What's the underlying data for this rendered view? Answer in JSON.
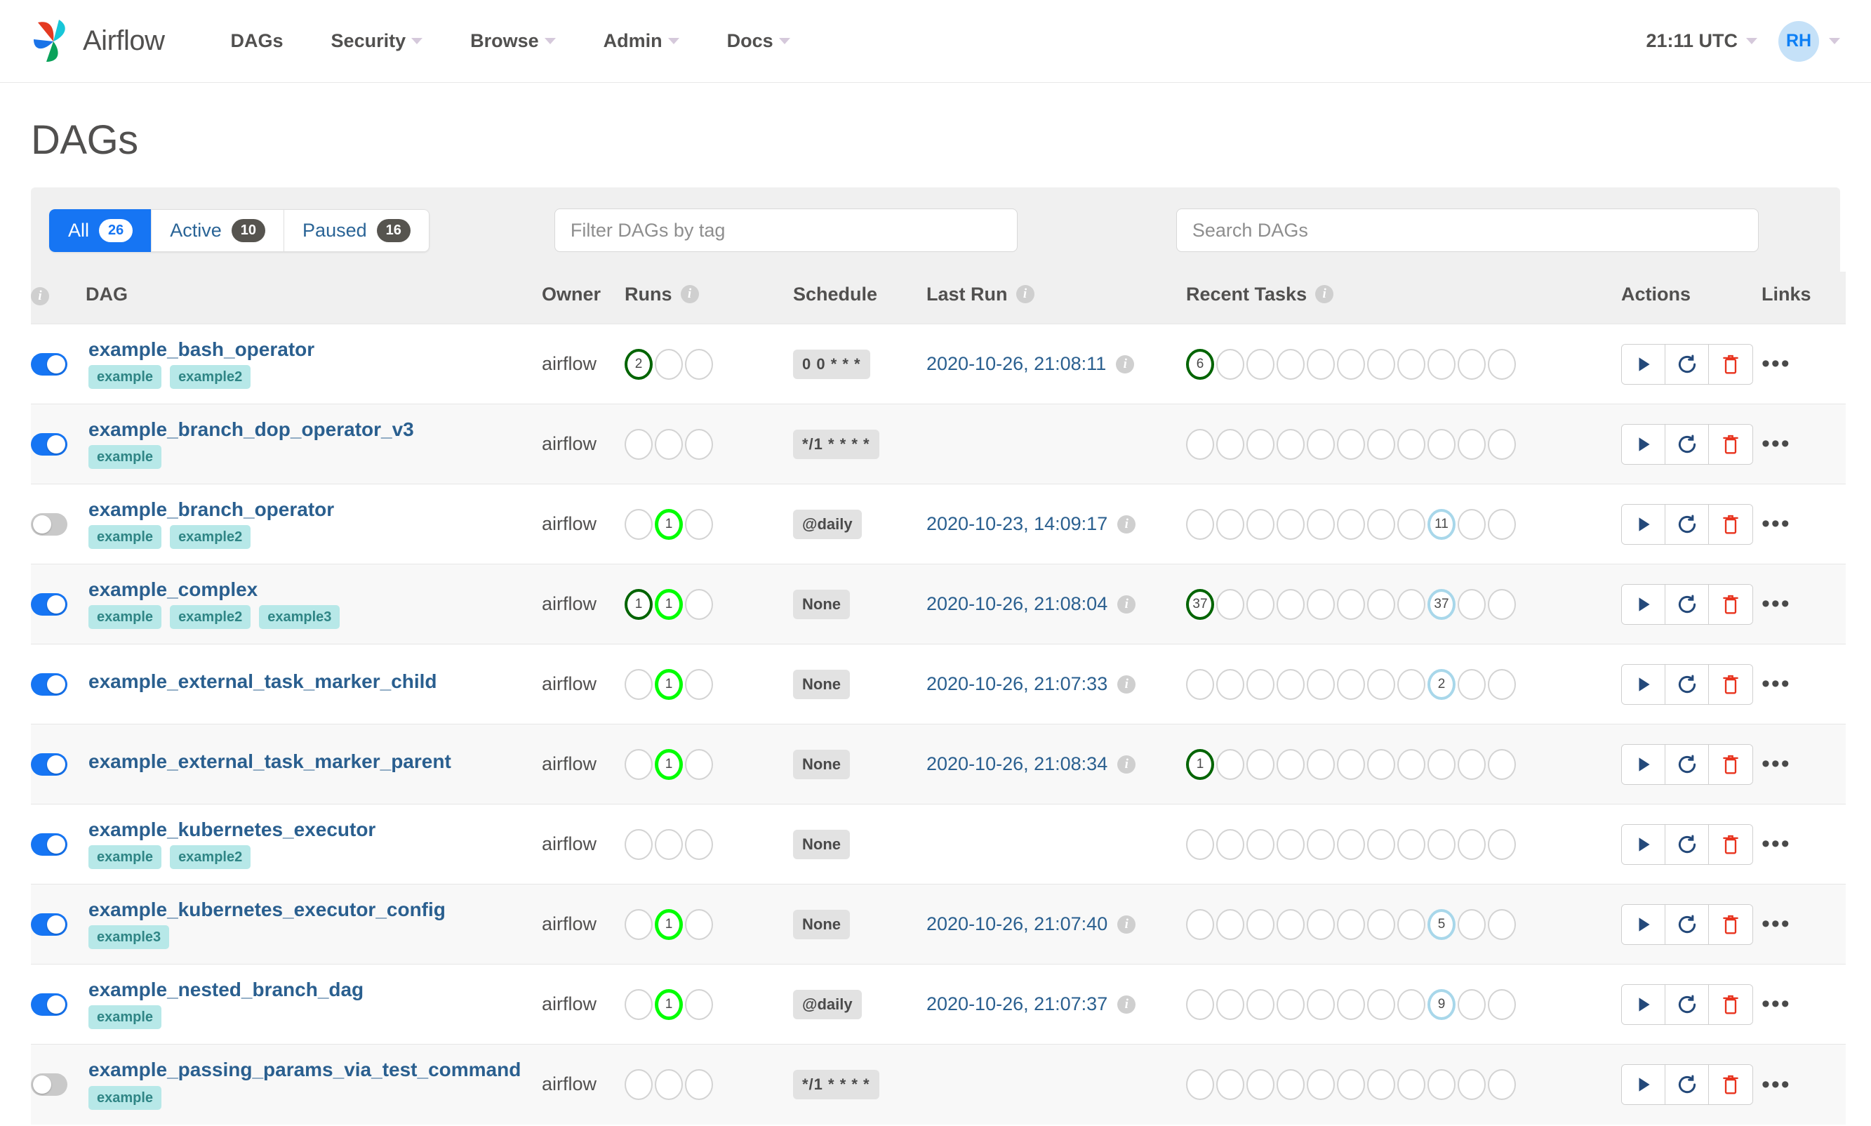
{
  "navbar": {
    "brand": "Airflow",
    "links": [
      {
        "label": "DAGs",
        "caret": false
      },
      {
        "label": "Security",
        "caret": true
      },
      {
        "label": "Browse",
        "caret": true
      },
      {
        "label": "Admin",
        "caret": true
      },
      {
        "label": "Docs",
        "caret": true
      }
    ],
    "time": "21:11 UTC",
    "avatar_initials": "RH"
  },
  "page": {
    "title": "DAGs"
  },
  "toolbar": {
    "tabs": [
      {
        "label": "All",
        "count": "26",
        "active": true
      },
      {
        "label": "Active",
        "count": "10",
        "active": false
      },
      {
        "label": "Paused",
        "count": "16",
        "active": false
      }
    ],
    "tag_filter_placeholder": "Filter DAGs by tag",
    "search_placeholder": "Search DAGs"
  },
  "table": {
    "headers": {
      "dag": "DAG",
      "owner": "Owner",
      "runs": "Runs",
      "schedule": "Schedule",
      "last_run": "Last Run",
      "recent_tasks": "Recent Tasks",
      "actions": "Actions",
      "links": "Links"
    },
    "action_icons": [
      "trigger-dag-icon",
      "refresh-icon",
      "delete-icon"
    ],
    "links_icon": "more-options-icon",
    "rows": [
      {
        "name": "example_bash_operator",
        "paused": false,
        "tags": [
          "example",
          "example2"
        ],
        "owner": "airflow",
        "runs": [
          {
            "state": "success",
            "count": "2"
          },
          {
            "state": "none",
            "count": ""
          },
          {
            "state": "none",
            "count": ""
          }
        ],
        "schedule": "0 0 * * *",
        "schedule_kind": "cron",
        "last_run": "2020-10-26, 21:08:11",
        "recent_tasks": [
          {
            "state": "success",
            "count": "6"
          },
          {
            "state": "none",
            "count": ""
          },
          {
            "state": "none",
            "count": ""
          },
          {
            "state": "none",
            "count": ""
          },
          {
            "state": "none",
            "count": ""
          },
          {
            "state": "none",
            "count": ""
          },
          {
            "state": "none",
            "count": ""
          },
          {
            "state": "none",
            "count": ""
          },
          {
            "state": "none",
            "count": ""
          },
          {
            "state": "none",
            "count": ""
          },
          {
            "state": "none",
            "count": ""
          }
        ]
      },
      {
        "name": "example_branch_dop_operator_v3",
        "paused": false,
        "tags": [
          "example"
        ],
        "owner": "airflow",
        "runs": [
          {
            "state": "none",
            "count": ""
          },
          {
            "state": "none",
            "count": ""
          },
          {
            "state": "none",
            "count": ""
          }
        ],
        "schedule": "*/1 * * * *",
        "schedule_kind": "cron",
        "last_run": "",
        "recent_tasks": [
          {
            "state": "none",
            "count": ""
          },
          {
            "state": "none",
            "count": ""
          },
          {
            "state": "none",
            "count": ""
          },
          {
            "state": "none",
            "count": ""
          },
          {
            "state": "none",
            "count": ""
          },
          {
            "state": "none",
            "count": ""
          },
          {
            "state": "none",
            "count": ""
          },
          {
            "state": "none",
            "count": ""
          },
          {
            "state": "none",
            "count": ""
          },
          {
            "state": "none",
            "count": ""
          },
          {
            "state": "none",
            "count": ""
          }
        ]
      },
      {
        "name": "example_branch_operator",
        "paused": true,
        "tags": [
          "example",
          "example2"
        ],
        "owner": "airflow",
        "runs": [
          {
            "state": "none",
            "count": ""
          },
          {
            "state": "running",
            "count": "1"
          },
          {
            "state": "none",
            "count": ""
          }
        ],
        "schedule": "@daily",
        "schedule_kind": "word",
        "last_run": "2020-10-23, 14:09:17",
        "recent_tasks": [
          {
            "state": "none",
            "count": ""
          },
          {
            "state": "none",
            "count": ""
          },
          {
            "state": "none",
            "count": ""
          },
          {
            "state": "none",
            "count": ""
          },
          {
            "state": "none",
            "count": ""
          },
          {
            "state": "none",
            "count": ""
          },
          {
            "state": "none",
            "count": ""
          },
          {
            "state": "none",
            "count": ""
          },
          {
            "state": "skipped",
            "count": "11"
          },
          {
            "state": "none",
            "count": ""
          },
          {
            "state": "none",
            "count": ""
          }
        ]
      },
      {
        "name": "example_complex",
        "paused": false,
        "tags": [
          "example",
          "example2",
          "example3"
        ],
        "owner": "airflow",
        "runs": [
          {
            "state": "success",
            "count": "1"
          },
          {
            "state": "running",
            "count": "1"
          },
          {
            "state": "none",
            "count": ""
          }
        ],
        "schedule": "None",
        "schedule_kind": "word",
        "last_run": "2020-10-26, 21:08:04",
        "recent_tasks": [
          {
            "state": "success",
            "count": "37"
          },
          {
            "state": "none",
            "count": ""
          },
          {
            "state": "none",
            "count": ""
          },
          {
            "state": "none",
            "count": ""
          },
          {
            "state": "none",
            "count": ""
          },
          {
            "state": "none",
            "count": ""
          },
          {
            "state": "none",
            "count": ""
          },
          {
            "state": "none",
            "count": ""
          },
          {
            "state": "skipped",
            "count": "37"
          },
          {
            "state": "none",
            "count": ""
          },
          {
            "state": "none",
            "count": ""
          }
        ]
      },
      {
        "name": "example_external_task_marker_child",
        "paused": false,
        "tags": [],
        "owner": "airflow",
        "runs": [
          {
            "state": "none",
            "count": ""
          },
          {
            "state": "running",
            "count": "1"
          },
          {
            "state": "none",
            "count": ""
          }
        ],
        "schedule": "None",
        "schedule_kind": "word",
        "last_run": "2020-10-26, 21:07:33",
        "recent_tasks": [
          {
            "state": "none",
            "count": ""
          },
          {
            "state": "none",
            "count": ""
          },
          {
            "state": "none",
            "count": ""
          },
          {
            "state": "none",
            "count": ""
          },
          {
            "state": "none",
            "count": ""
          },
          {
            "state": "none",
            "count": ""
          },
          {
            "state": "none",
            "count": ""
          },
          {
            "state": "none",
            "count": ""
          },
          {
            "state": "skipped",
            "count": "2"
          },
          {
            "state": "none",
            "count": ""
          },
          {
            "state": "none",
            "count": ""
          }
        ]
      },
      {
        "name": "example_external_task_marker_parent",
        "paused": false,
        "tags": [],
        "owner": "airflow",
        "runs": [
          {
            "state": "none",
            "count": ""
          },
          {
            "state": "running",
            "count": "1"
          },
          {
            "state": "none",
            "count": ""
          }
        ],
        "schedule": "None",
        "schedule_kind": "word",
        "last_run": "2020-10-26, 21:08:34",
        "recent_tasks": [
          {
            "state": "success",
            "count": "1"
          },
          {
            "state": "none",
            "count": ""
          },
          {
            "state": "none",
            "count": ""
          },
          {
            "state": "none",
            "count": ""
          },
          {
            "state": "none",
            "count": ""
          },
          {
            "state": "none",
            "count": ""
          },
          {
            "state": "none",
            "count": ""
          },
          {
            "state": "none",
            "count": ""
          },
          {
            "state": "none",
            "count": ""
          },
          {
            "state": "none",
            "count": ""
          },
          {
            "state": "none",
            "count": ""
          }
        ]
      },
      {
        "name": "example_kubernetes_executor",
        "paused": false,
        "tags": [
          "example",
          "example2"
        ],
        "owner": "airflow",
        "runs": [
          {
            "state": "none",
            "count": ""
          },
          {
            "state": "none",
            "count": ""
          },
          {
            "state": "none",
            "count": ""
          }
        ],
        "schedule": "None",
        "schedule_kind": "word",
        "last_run": "",
        "recent_tasks": [
          {
            "state": "none",
            "count": ""
          },
          {
            "state": "none",
            "count": ""
          },
          {
            "state": "none",
            "count": ""
          },
          {
            "state": "none",
            "count": ""
          },
          {
            "state": "none",
            "count": ""
          },
          {
            "state": "none",
            "count": ""
          },
          {
            "state": "none",
            "count": ""
          },
          {
            "state": "none",
            "count": ""
          },
          {
            "state": "none",
            "count": ""
          },
          {
            "state": "none",
            "count": ""
          },
          {
            "state": "none",
            "count": ""
          }
        ]
      },
      {
        "name": "example_kubernetes_executor_config",
        "paused": false,
        "tags": [
          "example3"
        ],
        "owner": "airflow",
        "runs": [
          {
            "state": "none",
            "count": ""
          },
          {
            "state": "running",
            "count": "1"
          },
          {
            "state": "none",
            "count": ""
          }
        ],
        "schedule": "None",
        "schedule_kind": "word",
        "last_run": "2020-10-26, 21:07:40",
        "recent_tasks": [
          {
            "state": "none",
            "count": ""
          },
          {
            "state": "none",
            "count": ""
          },
          {
            "state": "none",
            "count": ""
          },
          {
            "state": "none",
            "count": ""
          },
          {
            "state": "none",
            "count": ""
          },
          {
            "state": "none",
            "count": ""
          },
          {
            "state": "none",
            "count": ""
          },
          {
            "state": "none",
            "count": ""
          },
          {
            "state": "skipped",
            "count": "5"
          },
          {
            "state": "none",
            "count": ""
          },
          {
            "state": "none",
            "count": ""
          }
        ]
      },
      {
        "name": "example_nested_branch_dag",
        "paused": false,
        "tags": [
          "example"
        ],
        "owner": "airflow",
        "runs": [
          {
            "state": "none",
            "count": ""
          },
          {
            "state": "running",
            "count": "1"
          },
          {
            "state": "none",
            "count": ""
          }
        ],
        "schedule": "@daily",
        "schedule_kind": "word",
        "last_run": "2020-10-26, 21:07:37",
        "recent_tasks": [
          {
            "state": "none",
            "count": ""
          },
          {
            "state": "none",
            "count": ""
          },
          {
            "state": "none",
            "count": ""
          },
          {
            "state": "none",
            "count": ""
          },
          {
            "state": "none",
            "count": ""
          },
          {
            "state": "none",
            "count": ""
          },
          {
            "state": "none",
            "count": ""
          },
          {
            "state": "none",
            "count": ""
          },
          {
            "state": "skipped",
            "count": "9"
          },
          {
            "state": "none",
            "count": ""
          },
          {
            "state": "none",
            "count": ""
          }
        ]
      },
      {
        "name": "example_passing_params_via_test_command",
        "paused": true,
        "tags": [
          "example"
        ],
        "owner": "airflow",
        "runs": [
          {
            "state": "none",
            "count": ""
          },
          {
            "state": "none",
            "count": ""
          },
          {
            "state": "none",
            "count": ""
          }
        ],
        "schedule": "*/1 * * * *",
        "schedule_kind": "cron",
        "last_run": "",
        "recent_tasks": [
          {
            "state": "none",
            "count": ""
          },
          {
            "state": "none",
            "count": ""
          },
          {
            "state": "none",
            "count": ""
          },
          {
            "state": "none",
            "count": ""
          },
          {
            "state": "none",
            "count": ""
          },
          {
            "state": "none",
            "count": ""
          },
          {
            "state": "none",
            "count": ""
          },
          {
            "state": "none",
            "count": ""
          },
          {
            "state": "none",
            "count": ""
          },
          {
            "state": "none",
            "count": ""
          },
          {
            "state": "none",
            "count": ""
          }
        ]
      }
    ]
  },
  "colors": {
    "accent": "#1675f3",
    "success": "#006400",
    "running": "#01fe01",
    "skipped": "#a8d7ea",
    "danger": "#e8321d",
    "link": "#2a5f8f",
    "tag_bg": "#b7e8e8"
  }
}
